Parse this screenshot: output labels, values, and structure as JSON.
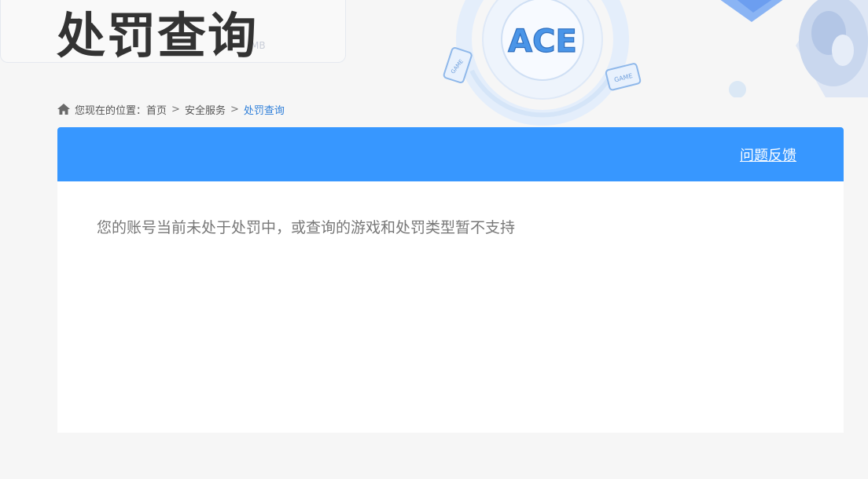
{
  "page": {
    "title": "处罚查询",
    "background_watermark": "MB"
  },
  "breadcrumb": {
    "prefix": "您现在的位置：",
    "items": [
      "首页",
      "安全服务",
      "处罚查询"
    ],
    "separator": ">"
  },
  "panel": {
    "feedback_label": "问题反馈",
    "message": "您的账号当前未处于处罚中，或查询的游戏和处罚类型暂不支持"
  },
  "logo": {
    "text": "ACE",
    "badges": [
      "GAME",
      "GAME"
    ]
  },
  "colors": {
    "accent": "#3797ff",
    "breadcrumb_current": "#2f7fd9",
    "title": "#333333",
    "message": "#777777"
  },
  "icons": {
    "home": "home-icon"
  }
}
